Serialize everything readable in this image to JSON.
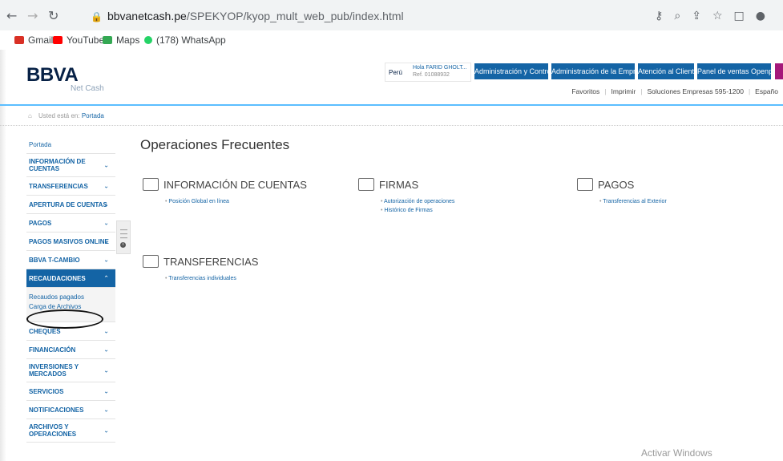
{
  "browser": {
    "url_domain": "bbvanetcash.pe",
    "url_path": "/SPEKYOP/kyop_mult_web_pub/index.html",
    "bookmarks": [
      {
        "label": "Gmail",
        "color": "#d93025"
      },
      {
        "label": "YouTube",
        "color": "#ff0000"
      },
      {
        "label": "Maps",
        "color": "#34a853"
      },
      {
        "label": "(178) WhatsApp",
        "color": "#25d366"
      }
    ]
  },
  "header": {
    "logo": "BBVA",
    "logo_sub": "Net Cash",
    "country": "Perú",
    "greeting": "Hola FARID GHOLT...",
    "ref": "Ref. 01088932",
    "buttons": [
      "Administración y Control",
      "Administración de la Empresa",
      "Atención al Cliente",
      "Panel de ventas Openpay"
    ],
    "util_links": [
      "Favoritos",
      "Imprimir",
      "Soluciones Empresas 595-1200",
      "Españo"
    ]
  },
  "breadcrumb": {
    "prefix": "Usted está en:",
    "current": "Portada"
  },
  "sidebar": {
    "items": [
      {
        "label": "Portada",
        "chevron": false
      },
      {
        "label": "INFORMACIÓN DE CUENTAS",
        "chevron": true
      },
      {
        "label": "TRANSFERENCIAS",
        "chevron": true
      },
      {
        "label": "APERTURA DE CUENTAS",
        "chevron": true
      },
      {
        "label": "PAGOS",
        "chevron": true
      },
      {
        "label": "PAGOS MASIVOS ONLINE",
        "chevron": true
      },
      {
        "label": "BBVA T-CAMBIO",
        "chevron": true
      },
      {
        "label": "RECAUDACIONES",
        "chevron": true,
        "active": true
      },
      {
        "label": "CHEQUES",
        "chevron": true
      },
      {
        "label": "FINANCIACIÓN",
        "chevron": true
      },
      {
        "label": "INVERSIONES Y MERCADOS",
        "chevron": true
      },
      {
        "label": "SERVICIOS",
        "chevron": true
      },
      {
        "label": "NOTIFICACIONES",
        "chevron": true
      },
      {
        "label": "ARCHIVOS Y OPERACIONES",
        "chevron": true
      }
    ],
    "sub_items": [
      "Recaudos pagados",
      "Carga de Archivos"
    ]
  },
  "main": {
    "title": "Operaciones Frecuentes",
    "sections": [
      {
        "title": "INFORMACIÓN DE CUENTAS",
        "links": [
          "Posición Global en línea"
        ]
      },
      {
        "title": "FIRMAS",
        "links": [
          "Autorización de operaciones",
          "Histórico de Firmas"
        ]
      },
      {
        "title": "PAGOS",
        "links": [
          "Transferencias al Exterior"
        ]
      },
      {
        "title": "TRANSFERENCIAS",
        "links": [
          "Transferencias individuales"
        ]
      }
    ]
  },
  "watermark": "Activar Windows",
  "colors": {
    "brand_blue": "#1464a5",
    "navy": "#072146",
    "accent_line": "#5bbeff",
    "purple": "#a5187a"
  }
}
